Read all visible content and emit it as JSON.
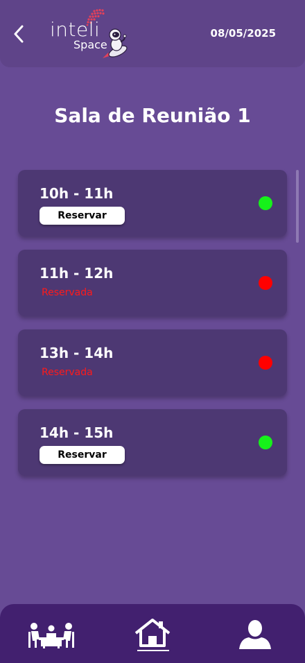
{
  "header": {
    "logo_text_1": "inteli",
    "logo_text_2": "Space",
    "date": "08/05/2025"
  },
  "room": {
    "title": "Sala de Reunião 1"
  },
  "slots": [
    {
      "time": "10h - 11h",
      "status": "available",
      "action_label": "Reservar",
      "dot_color": "#16f11a"
    },
    {
      "time": "11h - 12h",
      "status": "reserved",
      "reserved_label": "Reservada",
      "dot_color": "#ff0000"
    },
    {
      "time": "13h - 14h",
      "status": "reserved",
      "reserved_label": "Reservada",
      "dot_color": "#ff0000"
    },
    {
      "time": "14h - 15h",
      "status": "available",
      "action_label": "Reservar",
      "dot_color": "#16f11a"
    }
  ],
  "nav": {
    "items": [
      {
        "icon": "meeting-room-icon"
      },
      {
        "icon": "home-icon",
        "active": true
      },
      {
        "icon": "user-profile-icon"
      }
    ]
  },
  "colors": {
    "background": "#674b95",
    "header": "#5f4489",
    "card": "#4d3873",
    "bottom_nav": "#42206f",
    "available": "#16f11a",
    "reserved": "#ff0000"
  }
}
